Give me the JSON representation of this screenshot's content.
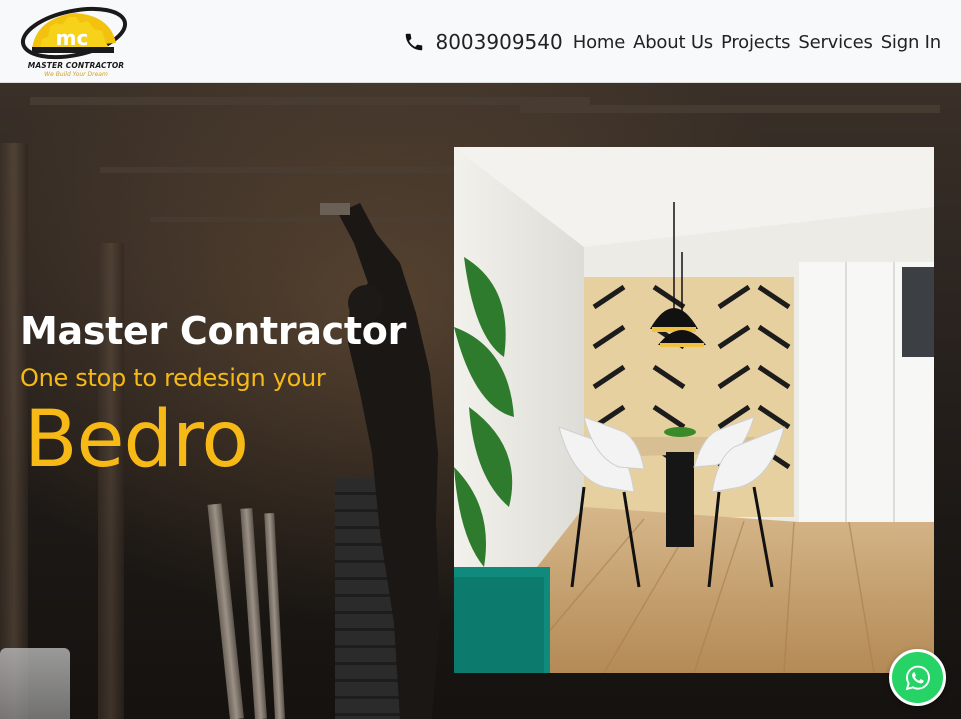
{
  "brand": {
    "logo_letters": "mc",
    "name": "MASTER CONTRACTOR",
    "tagline": "We Build Your Dream"
  },
  "header": {
    "phone": "8003909540",
    "nav": [
      "Home",
      "About Us",
      "Projects",
      "Services",
      "Sign In"
    ]
  },
  "hero": {
    "title": "Master Contractor",
    "subtitle": "One stop to redesign your",
    "typed_word": "Bedro"
  },
  "colors": {
    "accent": "#f7b916",
    "whatsapp": "#25d366"
  },
  "icons": {
    "phone": "phone-icon",
    "whatsapp": "whatsapp-icon"
  }
}
